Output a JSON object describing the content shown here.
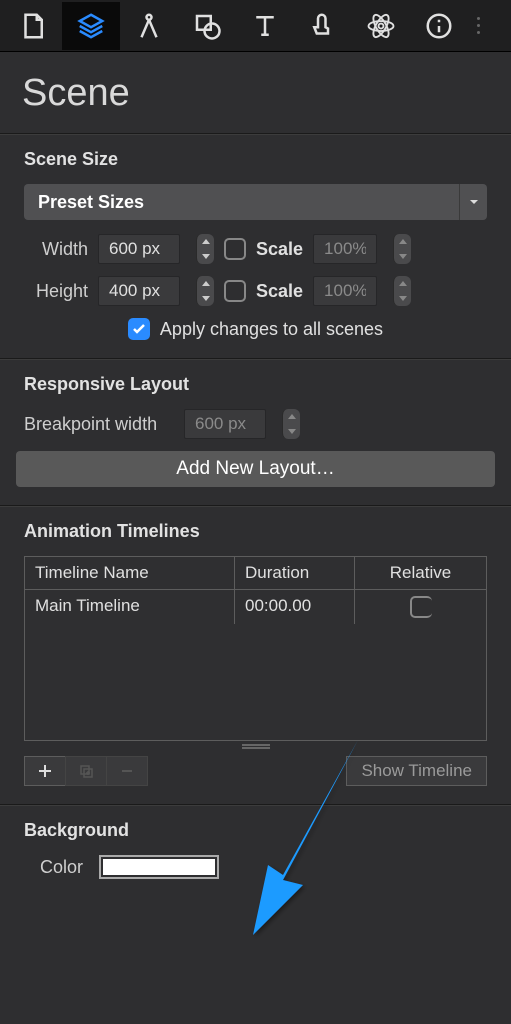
{
  "panel": {
    "title": "Scene"
  },
  "scene_size": {
    "header": "Scene Size",
    "preset_label": "Preset Sizes",
    "width_label": "Width",
    "width_value": "600 px",
    "height_label": "Height",
    "height_value": "400 px",
    "scale_label": "Scale",
    "scale_value": "100%",
    "apply_label": "Apply changes to all scenes"
  },
  "responsive": {
    "header": "Responsive Layout",
    "breakpoint_label": "Breakpoint width",
    "breakpoint_value": "600 px",
    "add_layout_label": "Add New Layout…"
  },
  "timelines": {
    "header": "Animation Timelines",
    "col_name": "Timeline Name",
    "col_duration": "Duration",
    "col_relative": "Relative",
    "rows": [
      {
        "name": "Main Timeline",
        "duration": "00:00.00",
        "relative": false
      }
    ],
    "show_timeline_label": "Show Timeline"
  },
  "background": {
    "header": "Background",
    "color_label": "Color",
    "color_value": "#ffffff"
  }
}
